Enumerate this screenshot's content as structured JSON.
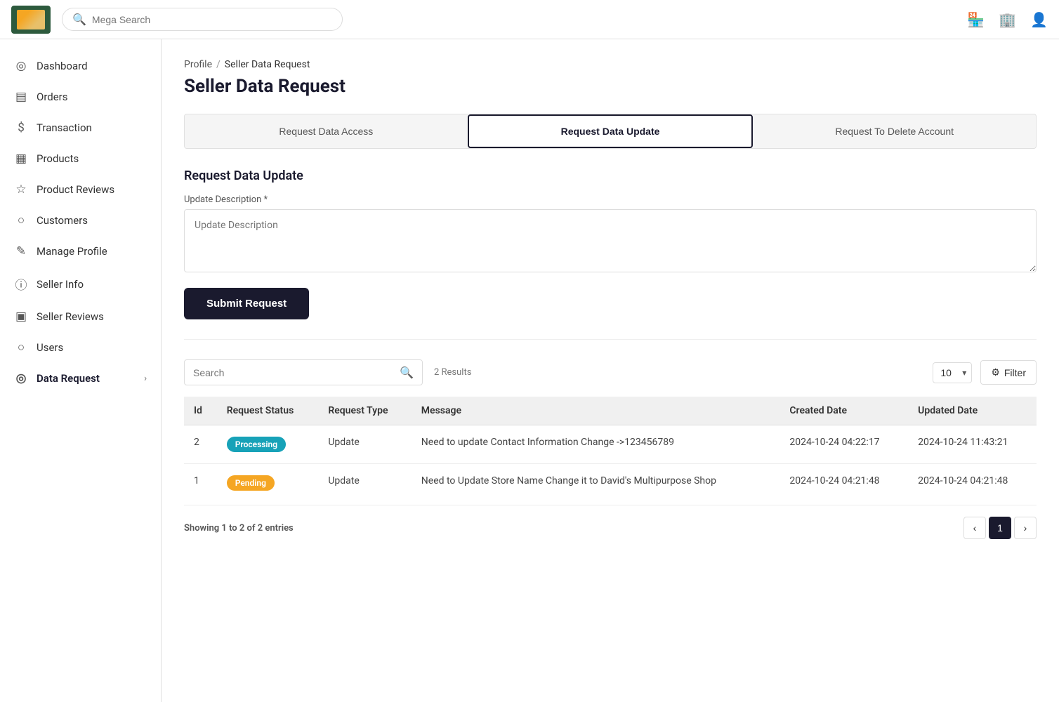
{
  "navbar": {
    "search_placeholder": "Mega Search",
    "icons": [
      "store-icon",
      "building-icon",
      "user-icon"
    ]
  },
  "sidebar": {
    "items": [
      {
        "id": "dashboard",
        "label": "Dashboard",
        "icon": "◎"
      },
      {
        "id": "orders",
        "label": "Orders",
        "icon": "☰"
      },
      {
        "id": "transaction",
        "label": "Transaction",
        "icon": "💲"
      },
      {
        "id": "products",
        "label": "Products",
        "icon": "▦"
      },
      {
        "id": "product-reviews",
        "label": "Product Reviews",
        "icon": "☆"
      },
      {
        "id": "customers",
        "label": "Customers",
        "icon": "👤"
      },
      {
        "id": "manage-profile",
        "label": "Manage Profile",
        "icon": "✎"
      },
      {
        "id": "seller-info",
        "label": "Seller Info",
        "icon": "ℹ"
      },
      {
        "id": "seller-reviews",
        "label": "Seller Reviews",
        "icon": "🖥"
      },
      {
        "id": "users",
        "label": "Users",
        "icon": "👤"
      },
      {
        "id": "data-request",
        "label": "Data Request",
        "icon": "◎",
        "has_arrow": true
      }
    ]
  },
  "breadcrumb": {
    "parent": "Profile",
    "separator": "/",
    "current": "Seller Data Request"
  },
  "page": {
    "title": "Seller Data Request"
  },
  "tabs": [
    {
      "id": "request-data-access",
      "label": "Request Data Access",
      "active": false
    },
    {
      "id": "request-data-update",
      "label": "Request Data Update",
      "active": true
    },
    {
      "id": "request-to-delete-account",
      "label": "Request To Delete Account",
      "active": false
    }
  ],
  "form": {
    "section_title": "Request Data Update",
    "update_description_label": "Update Description *",
    "update_description_placeholder": "Update Description",
    "submit_button": "Submit Request"
  },
  "table": {
    "results_text": "2 Results",
    "search_placeholder": "Search",
    "per_page_default": "10",
    "filter_label": "Filter",
    "columns": [
      "Id",
      "Request Status",
      "Request Type",
      "Message",
      "Created Date",
      "Updated Date"
    ],
    "rows": [
      {
        "id": "2",
        "status": "Processing",
        "status_type": "processing",
        "request_type": "Update",
        "message": "Need to update Contact Information Change ->123456789",
        "created_date": "2024-10-24 04:22:17",
        "updated_date": "2024-10-24 11:43:21"
      },
      {
        "id": "1",
        "status": "Pending",
        "status_type": "pending",
        "request_type": "Update",
        "message": "Need to Update Store Name Change it to David's Multipurpose Shop",
        "created_date": "2024-10-24 04:21:48",
        "updated_date": "2024-10-24 04:21:48"
      }
    ]
  },
  "pagination": {
    "showing_text": "Showing 1 to 2 of 2 entries",
    "current_page": "1"
  }
}
